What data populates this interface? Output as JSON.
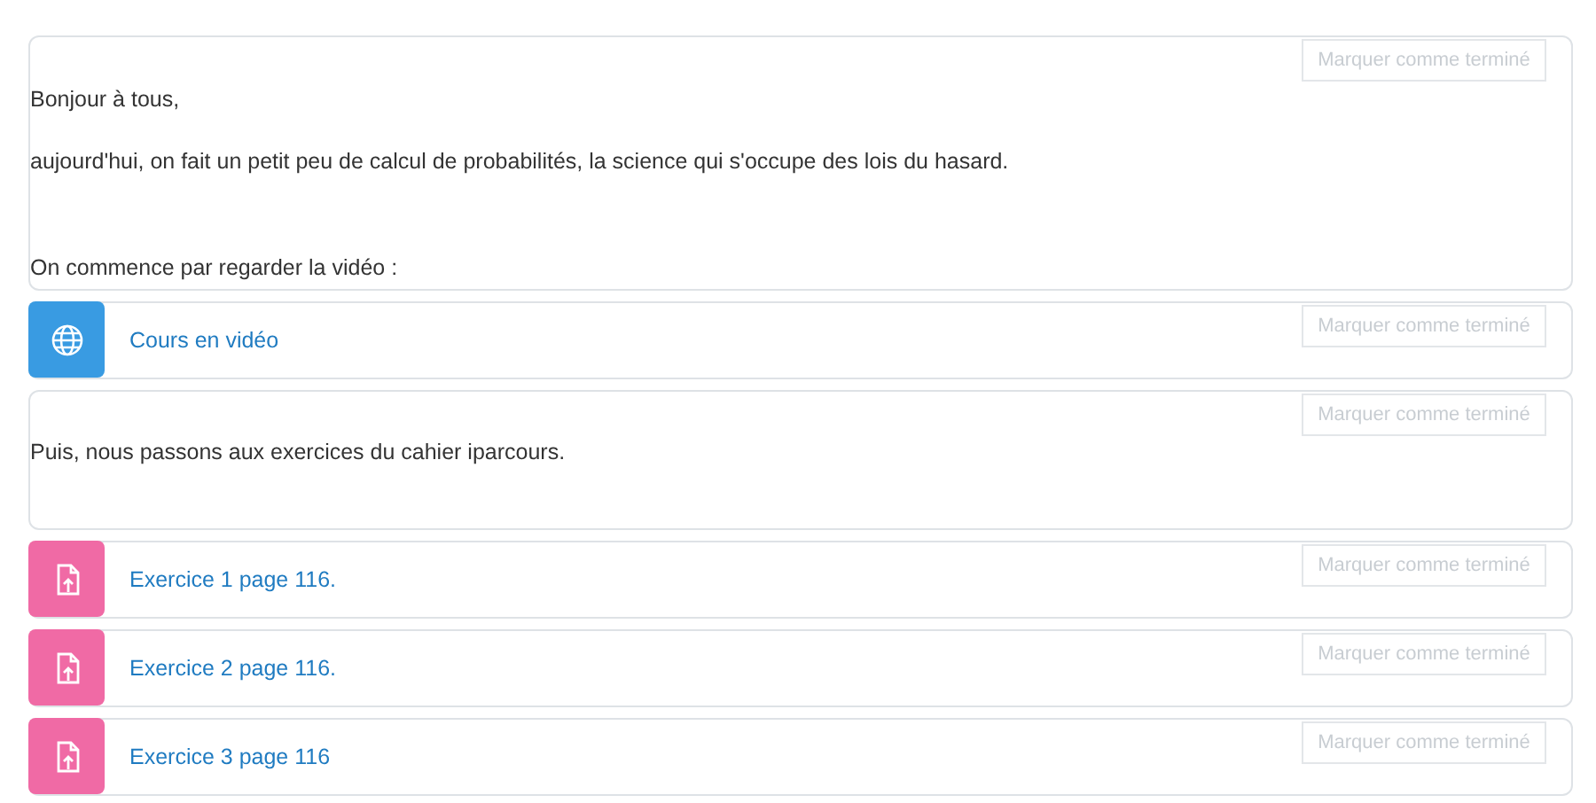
{
  "items": [
    {
      "kind": "label",
      "completion": {
        "label": "Marquer comme terminé",
        "disabled": true
      },
      "paragraphs": [
        "Bonjour à tous,",
        "aujourd'hui, on fait un petit peu de calcul de probabilités, la science qui s'occupe des lois du hasard.",
        "On commence par regarder la vidéo :"
      ]
    },
    {
      "kind": "url",
      "color": "#399be2",
      "title": "Cours en vidéo",
      "completion": {
        "label": "Marquer comme terminé",
        "disabled": true
      }
    },
    {
      "kind": "label",
      "completion": {
        "label": "Marquer comme terminé",
        "disabled": true
      },
      "paragraphs": [
        "Puis, nous passons aux exercices du cahier iparcours."
      ]
    },
    {
      "kind": "assign",
      "color": "#f06aa5",
      "title": "Exercice 1 page 116.",
      "completion": {
        "label": "Marquer comme terminé",
        "disabled": true
      }
    },
    {
      "kind": "assign",
      "color": "#f06aa5",
      "title": "Exercice 2 page 116.",
      "completion": {
        "label": "Marquer comme terminé",
        "disabled": true
      }
    },
    {
      "kind": "assign",
      "color": "#f06aa5",
      "title": "Exercice 3 page 116",
      "completion": {
        "label": "Marquer comme terminé",
        "disabled": true
      }
    }
  ]
}
